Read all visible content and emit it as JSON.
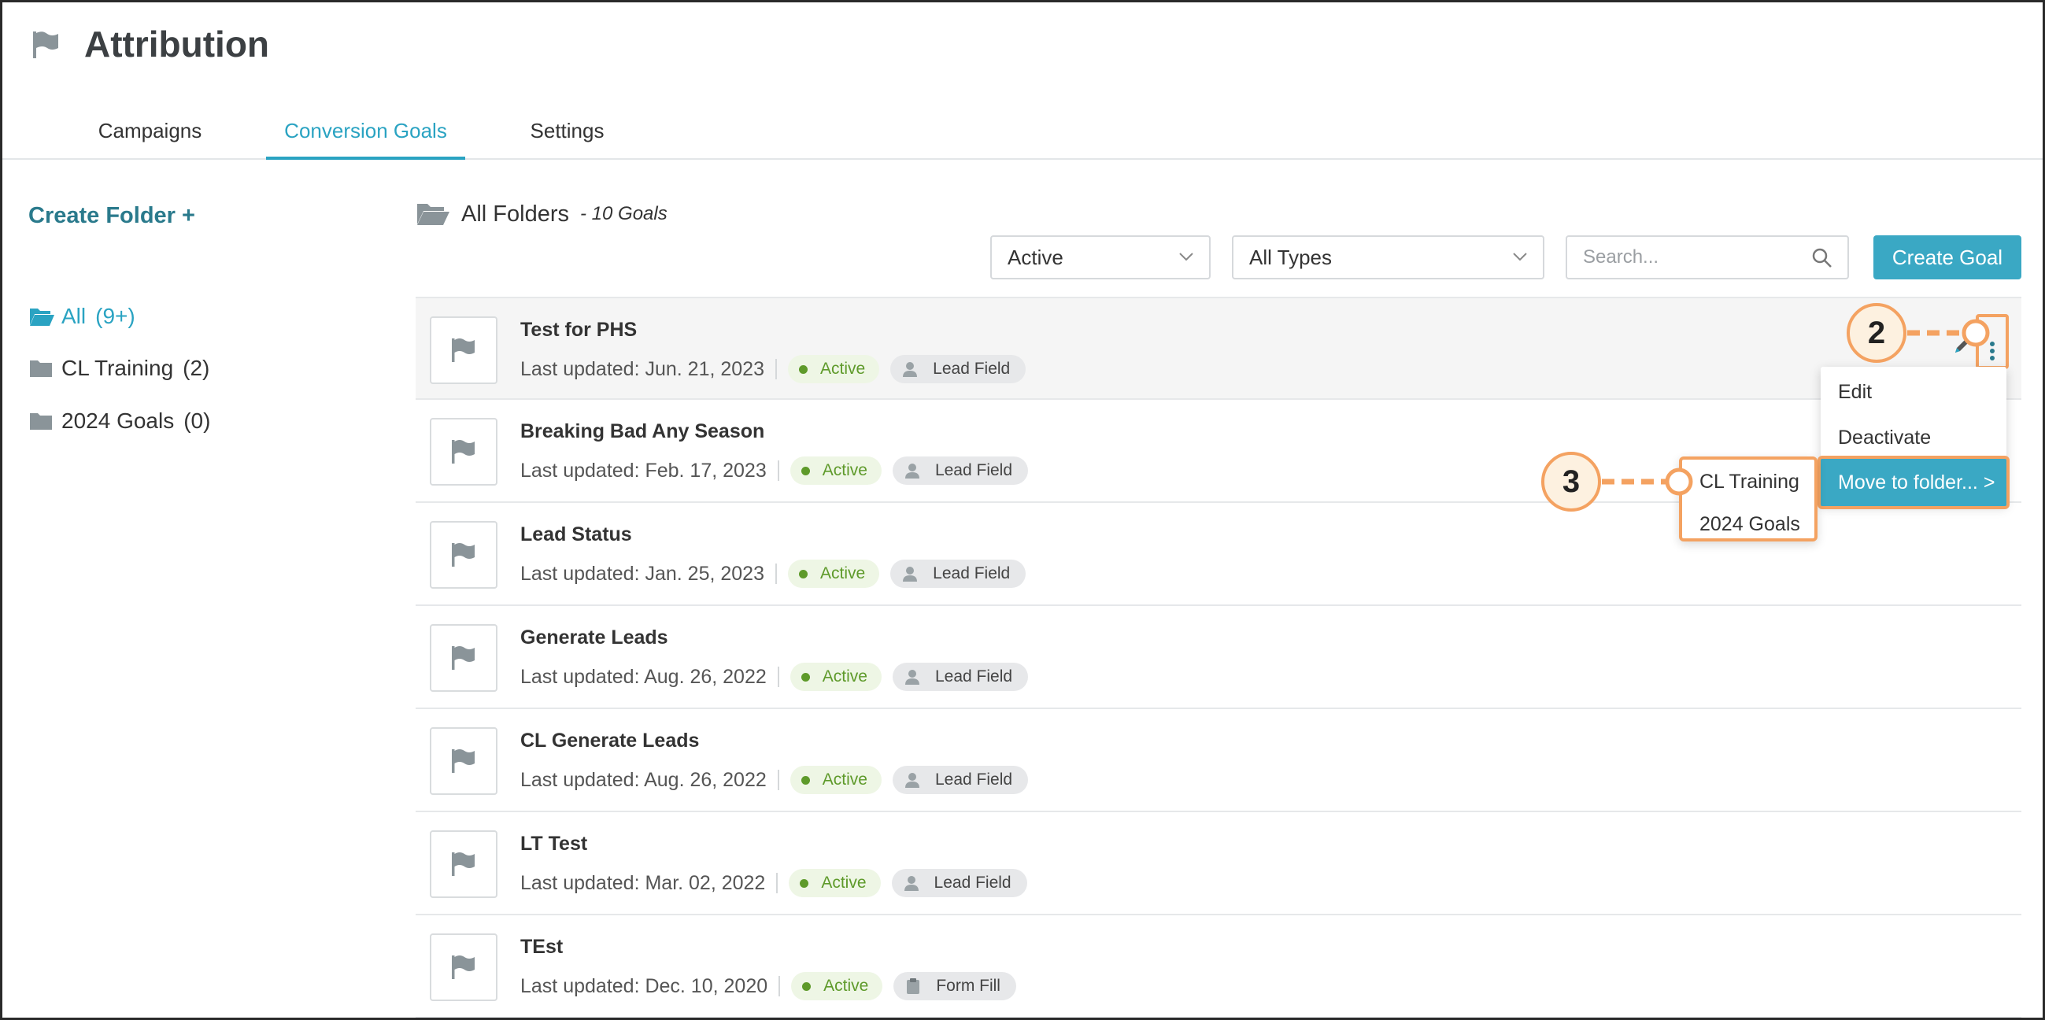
{
  "app": {
    "title": "Attribution"
  },
  "tabs": [
    {
      "label": "Campaigns"
    },
    {
      "label": "Conversion Goals"
    },
    {
      "label": "Settings"
    }
  ],
  "sidebar": {
    "create_folder_label": "Create Folder +",
    "folders": [
      {
        "label": "All",
        "count": "(9+)"
      },
      {
        "label": "CL Training",
        "count": "(2)"
      },
      {
        "label": "2024 Goals",
        "count": "(0)"
      }
    ]
  },
  "main": {
    "folder_title": "All Folders",
    "goal_count": "- 10 Goals",
    "filters": {
      "status": "Active",
      "type": "All Types"
    },
    "search": {
      "placeholder": "Search..."
    },
    "create_goal_label": "Create Goal"
  },
  "goals": [
    {
      "name": "Test for PHS",
      "updated": "Last updated: Jun. 21, 2023",
      "status": "Active",
      "type": "Lead Field"
    },
    {
      "name": "Breaking Bad Any Season",
      "updated": "Last updated: Feb. 17, 2023",
      "status": "Active",
      "type": "Lead Field"
    },
    {
      "name": "Lead Status",
      "updated": "Last updated: Jan. 25, 2023",
      "status": "Active",
      "type": "Lead Field"
    },
    {
      "name": "Generate Leads",
      "updated": "Last updated: Aug. 26, 2022",
      "status": "Active",
      "type": "Lead Field"
    },
    {
      "name": "CL Generate Leads",
      "updated": "Last updated: Aug. 26, 2022",
      "status": "Active",
      "type": "Lead Field"
    },
    {
      "name": "LT Test",
      "updated": "Last updated: Mar. 02, 2022",
      "status": "Active",
      "type": "Lead Field"
    },
    {
      "name": "TEst",
      "updated": "Last updated: Dec. 10, 2020",
      "status": "Active",
      "type": "Form Fill"
    }
  ],
  "context_menu": {
    "edit": "Edit",
    "deactivate": "Deactivate",
    "move": "Move to folder... >"
  },
  "submenu": [
    "CL Training",
    "2024 Goals"
  ],
  "callouts": {
    "step2": "2",
    "step3": "3"
  },
  "colors": {
    "accent": "#3aa8c4",
    "callout": "#f4a261",
    "active_green": "#5e9a2a"
  }
}
